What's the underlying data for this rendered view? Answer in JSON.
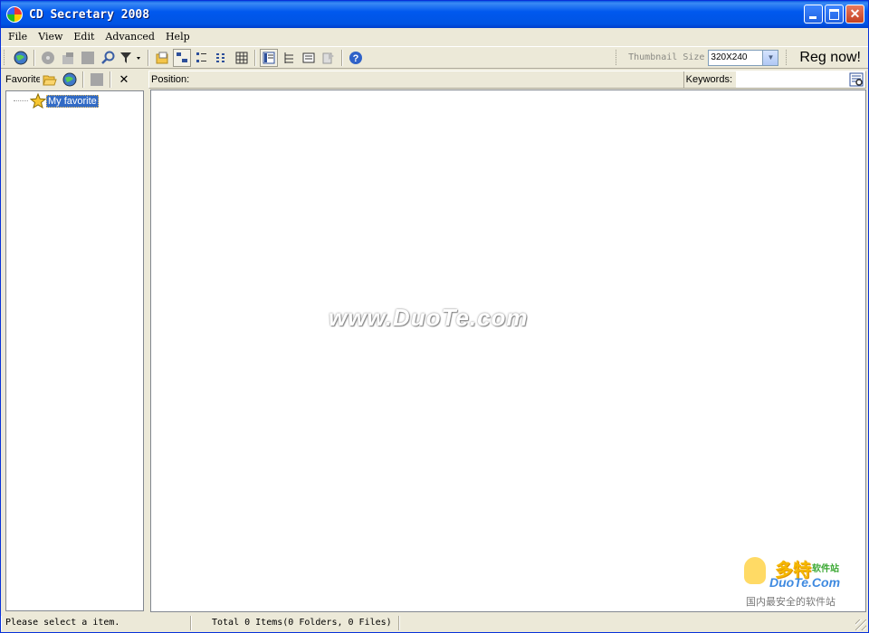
{
  "window": {
    "title": "CD Secretary 2008"
  },
  "menu": [
    "File",
    "View",
    "Edit",
    "Advanced",
    "Help"
  ],
  "toolbar": {
    "thumbnail_label": "Thumbnail Size",
    "thumbnail_value": "320X240",
    "reg_label": "Reg now!"
  },
  "left_panel": {
    "header_label": "Favorite",
    "tree_root": "My favorite"
  },
  "main": {
    "position_label": "Position:",
    "position_value": "",
    "keywords_label": "Keywords:",
    "keywords_value": "",
    "watermark": "www.DuoTe.com"
  },
  "corner_logo": {
    "cn_title": "多特",
    "cn_sub": "软件站",
    "en": "DuoTe.Com",
    "tagline": "国内最安全的软件站"
  },
  "statusbar": {
    "message": "Please select a item.",
    "totals": "Total 0 Items(0 Folders, 0 Files)"
  },
  "colors": {
    "titlebar": "#0054e3",
    "selection": "#316ac5",
    "chrome": "#ece9d8"
  }
}
